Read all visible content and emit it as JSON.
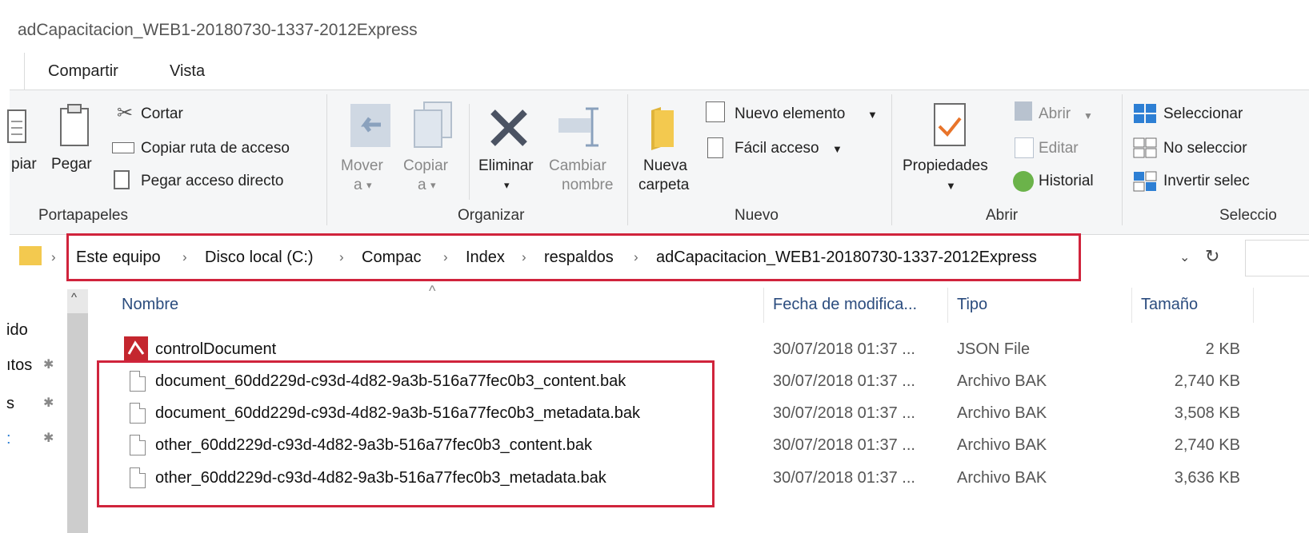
{
  "window": {
    "title": "adCapacitacion_WEB1-20180730-1337-2012Express"
  },
  "tabs": [
    "Compartir",
    "Vista"
  ],
  "ribbon": {
    "portapapeles": {
      "copiar": "piar",
      "pegar": "Pegar",
      "cortar": "Cortar",
      "copiar_ruta": "Copiar ruta de acceso",
      "pegar_acceso": "Pegar acceso directo",
      "label": "Portapapeles"
    },
    "organizar": {
      "mover_line1": "Mover",
      "mover_line2": "a",
      "copiar_line1": "Copiar",
      "copiar_line2": "a",
      "eliminar": "Eliminar",
      "cambiar_line1": "Cambiar",
      "cambiar_line2": "nombre",
      "label": "Organizar"
    },
    "nuevo": {
      "nueva_line1": "Nueva",
      "nueva_line2": "carpeta",
      "nuevo_elemento": "Nuevo elemento",
      "facil_acceso": "Fácil acceso",
      "label": "Nuevo"
    },
    "abrir": {
      "propiedades": "Propiedades",
      "abrir": "Abrir",
      "editar": "Editar",
      "historial": "Historial",
      "label": "Abrir"
    },
    "seleccionar": {
      "seleccionar_todo": "Seleccionar",
      "no_seleccionar": "No seleccior",
      "invertir": "Invertir selec",
      "label": "Seleccio"
    }
  },
  "address": {
    "crumbs": [
      "Este equipo",
      "Disco local (C:)",
      "Compac",
      "Index",
      "respaldos",
      "adCapacitacion_WEB1-20180730-1337-2012Express"
    ]
  },
  "nav": {
    "items": [
      "ido",
      "ıtos",
      "s",
      ":"
    ]
  },
  "columns": {
    "name": "Nombre",
    "date": "Fecha de modifica...",
    "type": "Tipo",
    "size": "Tamaño"
  },
  "files": [
    {
      "name": "controlDocument",
      "date": "30/07/2018 01:37 ...",
      "type": "JSON File",
      "size": "2 KB"
    },
    {
      "name": "document_60dd229d-c93d-4d82-9a3b-516a77fec0b3_content.bak",
      "date": "30/07/2018 01:37 ...",
      "type": "Archivo BAK",
      "size": "2,740 KB"
    },
    {
      "name": "document_60dd229d-c93d-4d82-9a3b-516a77fec0b3_metadata.bak",
      "date": "30/07/2018 01:37 ...",
      "type": "Archivo BAK",
      "size": "3,508 KB"
    },
    {
      "name": "other_60dd229d-c93d-4d82-9a3b-516a77fec0b3_content.bak",
      "date": "30/07/2018 01:37 ...",
      "type": "Archivo BAK",
      "size": "2,740 KB"
    },
    {
      "name": "other_60dd229d-c93d-4d82-9a3b-516a77fec0b3_metadata.bak",
      "date": "30/07/2018 01:37 ...",
      "type": "Archivo BAK",
      "size": "3,636 KB"
    }
  ],
  "colors": {
    "highlight": "#d0243c",
    "folder": "#f3c94f",
    "header_text": "#2b4c7e"
  }
}
